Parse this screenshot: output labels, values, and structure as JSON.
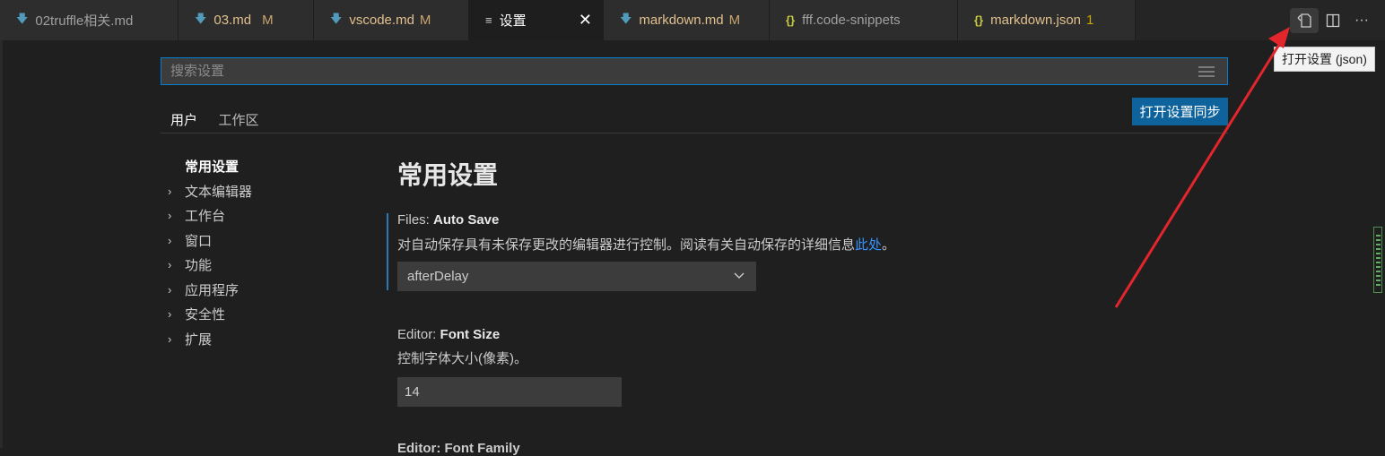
{
  "tabs": [
    {
      "label": "02truffle相关.md",
      "kind": "md",
      "status": ""
    },
    {
      "label": "03.md",
      "kind": "md",
      "status": "M"
    },
    {
      "label": "vscode.md",
      "kind": "md",
      "status": "M"
    },
    {
      "label": "设置",
      "kind": "settings",
      "status": ""
    },
    {
      "label": "markdown.md",
      "kind": "md",
      "status": "M"
    },
    {
      "label": "fff.code-snippets",
      "kind": "json",
      "status": ""
    },
    {
      "label": "markdown.json",
      "kind": "json",
      "status": "1"
    }
  ],
  "icons": {
    "md": "arrow-down-icon",
    "json": "curly-braces-icon",
    "settings": "settings-lines-icon"
  },
  "editor_actions": {
    "tooltip": "打开设置 (json)",
    "more": "···"
  },
  "search": {
    "placeholder": "搜索设置",
    "value": ""
  },
  "scope_tabs": {
    "user": "用户",
    "workspace": "工作区"
  },
  "sync_button": "打开设置同步",
  "toc": [
    {
      "label": "常用设置",
      "current": true
    },
    {
      "label": "文本编辑器",
      "current": false
    },
    {
      "label": "工作台",
      "current": false
    },
    {
      "label": "窗口",
      "current": false
    },
    {
      "label": "功能",
      "current": false
    },
    {
      "label": "应用程序",
      "current": false
    },
    {
      "label": "安全性",
      "current": false
    },
    {
      "label": "扩展",
      "current": false
    }
  ],
  "section_title": "常用设置",
  "settings": {
    "auto_save": {
      "category": "Files: ",
      "name": "Auto Save",
      "description": "对自动保存具有未保存更改的编辑器进行控制。阅读有关自动保存的详细信息",
      "link": "此处",
      "trailing": "。",
      "value": "afterDelay"
    },
    "font_size": {
      "category": "Editor: ",
      "name": "Font Size",
      "description": "控制字体大小(像素)。",
      "value": "14"
    },
    "font_family_cut": {
      "category": "Editor: ",
      "name": "Font Family"
    }
  },
  "colors": {
    "accent": "#007fd4",
    "button": "#0e639c",
    "modified": "#e2c08d",
    "arrow": "#e3262c"
  }
}
